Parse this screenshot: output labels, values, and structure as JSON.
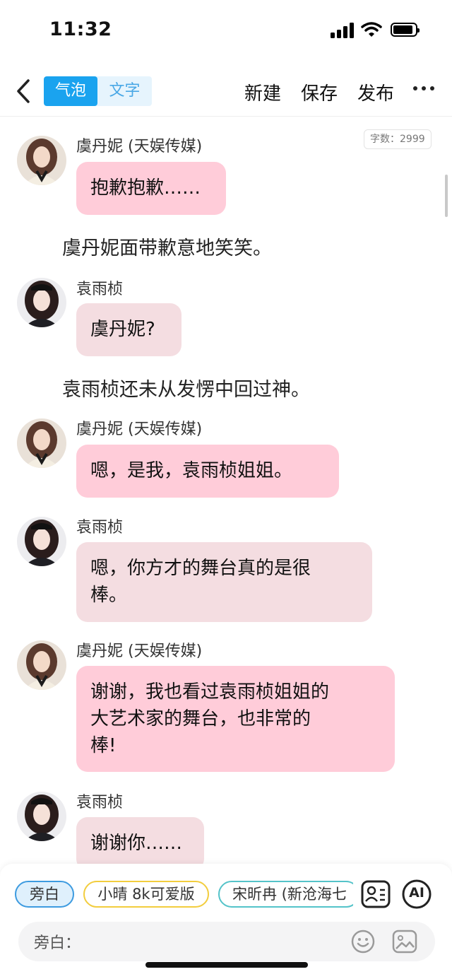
{
  "status_bar": {
    "time": "11:32"
  },
  "nav": {
    "mode_bubble": "气泡",
    "mode_text": "文字",
    "new_label": "新建",
    "save_label": "保存",
    "publish_label": "发布"
  },
  "word_count": "字数：2999",
  "messages": [
    {
      "type": "bubble",
      "speaker": "虞丹妮 (天娱传媒)",
      "lines": [
        "抱歉抱歉……"
      ]
    },
    {
      "type": "narration",
      "text": "虞丹妮面带歉意地笑笑。"
    },
    {
      "type": "bubble",
      "speaker": "袁雨桢",
      "lines": [
        "虞丹妮?"
      ]
    },
    {
      "type": "narration",
      "text": "袁雨桢还未从发愣中回过神。"
    },
    {
      "type": "bubble",
      "speaker": "虞丹妮 (天娱传媒)",
      "lines": [
        "嗯，是我，袁雨桢姐姐。"
      ]
    },
    {
      "type": "bubble",
      "speaker": "袁雨桢",
      "lines": [
        "嗯，你方才的舞台真的是很",
        "棒。"
      ]
    },
    {
      "type": "bubble",
      "speaker": "虞丹妮 (天娱传媒)",
      "lines": [
        "谢谢，我也看过袁雨桢姐姐的",
        "大艺术家的舞台，也非常的",
        "棒!"
      ]
    },
    {
      "type": "bubble",
      "speaker": "袁雨桢",
      "lines": [
        "谢谢你……"
      ]
    }
  ],
  "role_chips": [
    "旁白",
    "小晴 8k可爱版",
    "宋昕冉 (新沧海七"
  ],
  "tools": {
    "ai_label": "AI"
  },
  "input": {
    "label": "旁白："
  },
  "colors": {
    "accent": "#1aa3ef",
    "bubble_pink": "#ffccd9",
    "bubble_rose": "#f4dde1",
    "chip_narration": "#3d9be0",
    "chip_yellow": "#f2cd3e",
    "chip_teal": "#54c3c9"
  },
  "icons": [
    "back-chevron-icon",
    "more-icon",
    "contact-card-icon",
    "ai-icon",
    "emoji-icon",
    "image-icon",
    "signal-icon",
    "wifi-icon",
    "battery-icon"
  ]
}
